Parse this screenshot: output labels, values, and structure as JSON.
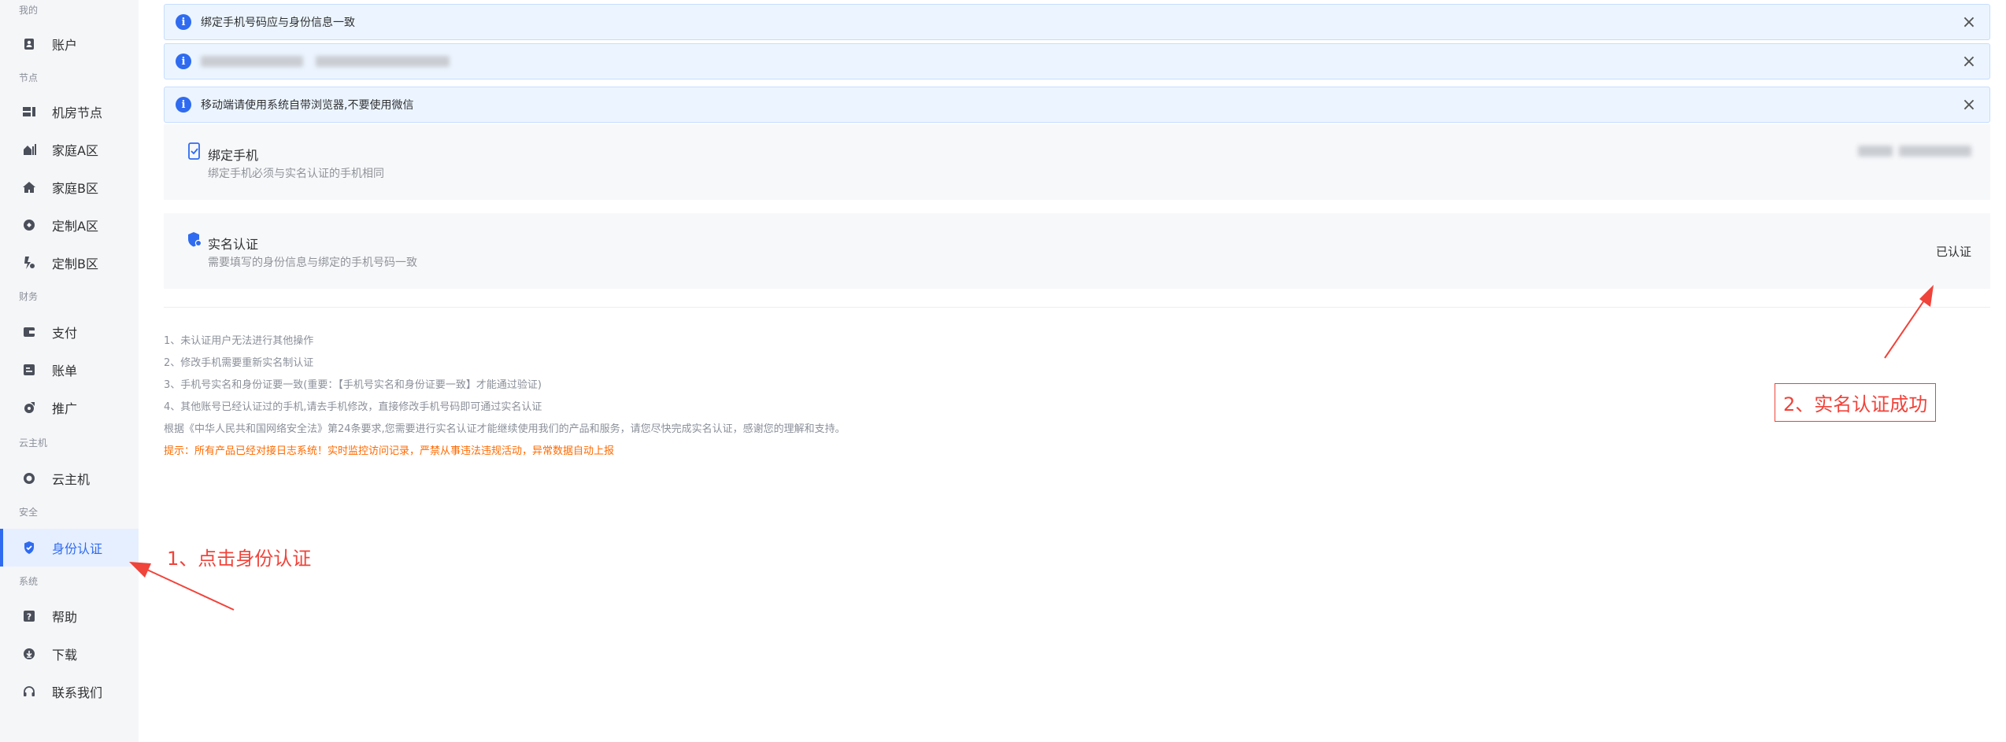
{
  "sidebar": {
    "groups": [
      {
        "title": "我的",
        "items": [
          {
            "label": "账户",
            "icon": "user-card-icon"
          }
        ]
      },
      {
        "title": "节点",
        "items": [
          {
            "label": "机房节点",
            "icon": "server-rack-icon"
          },
          {
            "label": "家庭A区",
            "icon": "home-signal-icon"
          },
          {
            "label": "家庭B区",
            "icon": "home-icon"
          },
          {
            "label": "定制A区",
            "icon": "custom-a-icon"
          },
          {
            "label": "定制B区",
            "icon": "custom-b-icon"
          }
        ]
      },
      {
        "title": "财务",
        "items": [
          {
            "label": "支付",
            "icon": "wallet-icon"
          },
          {
            "label": "账单",
            "icon": "bill-icon"
          },
          {
            "label": "推广",
            "icon": "promote-icon"
          }
        ]
      },
      {
        "title": "云主机",
        "items": [
          {
            "label": "云主机",
            "icon": "cloud-icon"
          }
        ]
      },
      {
        "title": "安全",
        "items": [
          {
            "label": "身份认证",
            "icon": "shield-check-icon",
            "active": true
          }
        ]
      },
      {
        "title": "系统",
        "items": [
          {
            "label": "帮助",
            "icon": "help-icon"
          },
          {
            "label": "下载",
            "icon": "download-icon"
          },
          {
            "label": "联系我们",
            "icon": "headset-icon"
          }
        ]
      }
    ]
  },
  "alerts": [
    {
      "text": "绑定手机号码应与身份信息一致"
    },
    {
      "text": ""
    },
    {
      "text": "移动端请使用系统自带浏览器,不要使用微信"
    }
  ],
  "cards": {
    "phone": {
      "title": "绑定手机",
      "desc": "绑定手机必须与实名认证的手机相同"
    },
    "realname": {
      "title": "实名认证",
      "desc": "需要填写的身份信息与绑定的手机号码一致",
      "status": "已认证"
    }
  },
  "notes": [
    "1、未认证用户无法进行其他操作",
    "2、修改手机需要重新实名制认证",
    "3、手机号实名和身份证要一致(重要：【手机号实名和身份证要一致】才能通过验证)",
    "4、其他账号已经认证过的手机,请去手机修改，直接修改手机号码即可通过实名认证",
    "根据《中华人民共和国网络安全法》第24条要求,您需要进行实名认证才能继续使用我们的产品和服务，请您尽快完成实名认证，感谢您的理解和支持。"
  ],
  "warning": "提示：所有产品已经对接日志系统！实时监控访问记录，严禁从事违法违规活动，异常数据自动上报",
  "annotations": {
    "step1": "1、点击身份认证",
    "step2": "2、实名认证成功"
  },
  "colors": {
    "accent": "#2f6bf0",
    "annotation": "#f0433a",
    "warning": "#ff6a00"
  }
}
